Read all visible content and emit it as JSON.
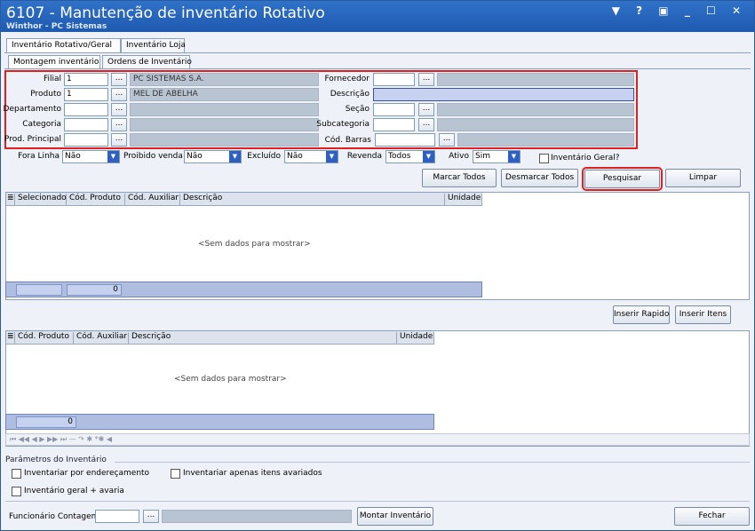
{
  "window": {
    "title": "6107 - Manutenção de inventário Rotativo",
    "subtitle": "Winthor - PC Sistemas",
    "controls": "▼ ? ▣ _ ☐ ✕"
  },
  "tabs_main": [
    "Inventário Rotativo/Geral",
    "Inventário Loja"
  ],
  "tabs_sub": [
    "Montagem inventário",
    "Ordens de Inventário"
  ],
  "form": {
    "filial_label": "Filial",
    "filial_value": "1",
    "filial_desc": "PC SISTEMAS S.A.",
    "produto_label": "Produto",
    "produto_value": "1",
    "produto_desc": "MEL DE ABELHA",
    "departamento_label": "Departamento",
    "categoria_label": "Categoria",
    "prod_principal_label": "Prod. Principal",
    "fornecedor_label": "Fornecedor",
    "descricao_label": "Descrição",
    "secao_label": "Seção",
    "subcategoria_label": "Subcategoria",
    "cod_barras_label": "Cód. Barras",
    "ellipsis": "..."
  },
  "filters": {
    "fora_linha_label": "Fora Linha",
    "fora_linha_value": "Não",
    "proibido_venda_label": "Proibido venda",
    "proibido_venda_value": "Não",
    "excluido_label": "Excluído",
    "excluido_value": "Não",
    "revenda_label": "Revenda",
    "revenda_value": "Todos",
    "ativo_label": "Ativo",
    "ativo_value": "Sim",
    "inventario_geral_label": "Inventário Geral?"
  },
  "buttons": {
    "marcar_todos": "Marcar Todos",
    "desmarcar_todos": "Desmarcar Todos",
    "pesquisar": "Pesquisar",
    "limpar": "Limpar",
    "inserir_rapido": "Inserir Rapido",
    "inserir_itens": "Inserir Itens",
    "montar_inventario": "Montar Inventário",
    "fechar": "Fechar"
  },
  "grid1": {
    "columns": [
      "Selecionado",
      "Cód. Produto",
      "Cód. Auxiliar",
      "Descrição",
      "Unidade"
    ],
    "empty_text": "<Sem dados para mostrar>",
    "footer_count": "0"
  },
  "grid2": {
    "columns": [
      "Cód. Produto",
      "Cód. Auxiliar",
      "Descrição",
      "Unidade"
    ],
    "empty_text": "<Sem dados para mostrar>",
    "footer_count": "0",
    "nav": "⏮ ◀◀ ◀ ▶ ▶▶ ⏭ — ↷ ✱ *✱        ◀"
  },
  "params": {
    "group_label": "Parâmetros do Inventário",
    "por_endereco": "Inventariar por endereçamento",
    "apenas_avariados": "Inventariar apenas itens avariados",
    "geral_avaria": "Inventário geral + avaria"
  },
  "bottom": {
    "funcionario_label": "Funcionário Contagem"
  },
  "colors": {
    "title_bg": "#1f59b0",
    "highlight": "#e02020"
  }
}
